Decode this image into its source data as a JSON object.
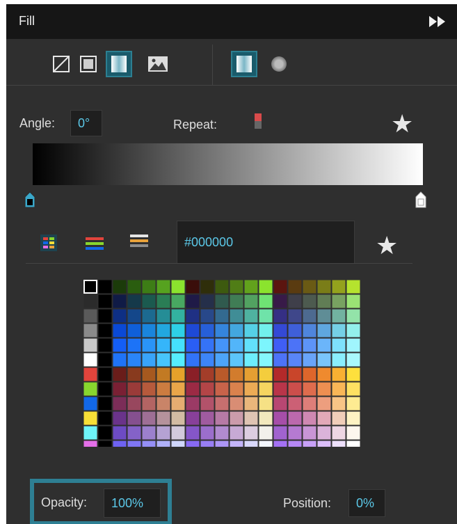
{
  "panel": {
    "title": "Fill"
  },
  "fill_type_tools": [
    {
      "name": "no-fill-icon",
      "selected": false
    },
    {
      "name": "solid-fill-icon",
      "selected": false
    },
    {
      "name": "linear-gradient-icon",
      "selected": true
    },
    {
      "name": "image-fill-icon",
      "selected": false
    }
  ],
  "gradient_type_tools": [
    {
      "name": "linear-gradient-icon",
      "selected": true
    },
    {
      "name": "radial-gradient-icon",
      "selected": false
    }
  ],
  "gradient": {
    "angle_label": "Angle:",
    "angle_value": "0°",
    "repeat_label": "Repeat:",
    "start_color": "#000000",
    "end_color": "#ffffff"
  },
  "color_input": {
    "value": "#000000"
  },
  "swatches": {
    "colors": [
      "#000000",
      "#000000",
      "#1b3b0a",
      "#2a5d0f",
      "#3d7d16",
      "#56a21f",
      "#8be32e",
      "#3a0e0a",
      "#2f2e0a",
      "#3d5a0f",
      "#507d16",
      "#62a21c",
      "#8be32e",
      "#5b150f",
      "#5a3b10",
      "#6a5a14",
      "#7a7d18",
      "#94a21d",
      "#b5e32e",
      "#2b2b2b",
      "#000000",
      "#101b46",
      "#15394a",
      "#1b5a4f",
      "#2a7d55",
      "#48a861",
      "#1f1a47",
      "#252f4a",
      "#305a4e",
      "#407d55",
      "#52a261",
      "#6fe374",
      "#381a48",
      "#3f3f4a",
      "#4d5a4f",
      "#617d55",
      "#78a261",
      "#9ae374",
      "#5a5a5a",
      "#000000",
      "#0e2f84",
      "#14478a",
      "#1c6a90",
      "#258d96",
      "#33b2a0",
      "#1f3084",
      "#28488a",
      "#336a90",
      "#408d96",
      "#4fb2a0",
      "#6fe3a9",
      "#352f84",
      "#3f478a",
      "#4d6a90",
      "#5f8d96",
      "#72b2a0",
      "#93e3a9",
      "#8a8a8a",
      "#000000",
      "#0a49d6",
      "#0f5fd9",
      "#1a85dc",
      "#22a7df",
      "#2ed0e6",
      "#1e49d6",
      "#275fd9",
      "#3585dc",
      "#43a7df",
      "#55d0e6",
      "#72f0ec",
      "#3449d6",
      "#3f5fd9",
      "#4f85dc",
      "#5fa7df",
      "#75d0e6",
      "#93f0ec",
      "#c8c8c8",
      "#000000",
      "#145ef5",
      "#1c73f7",
      "#2a94f8",
      "#35b5fa",
      "#45e1fc",
      "#2a5ef5",
      "#3573f7",
      "#4594f8",
      "#52b5fa",
      "#62e1fc",
      "#7cf5fd",
      "#405ef5",
      "#4c73f7",
      "#5d94f8",
      "#6bb5fa",
      "#7ee1fc",
      "#a0f5fd",
      "#ffffff",
      "#000000",
      "#1f73f7",
      "#2a85f8",
      "#39a4f9",
      "#47c5fb",
      "#56eefd",
      "#3273f7",
      "#3d85f8",
      "#4da4f9",
      "#5cc5fb",
      "#6deefd",
      "#85f8fd",
      "#4d73f7",
      "#5985f8",
      "#69a4f9",
      "#79c5fb",
      "#8aeefd",
      "#a9f8fd",
      "#e2443c",
      "#000000",
      "#6a1d1a",
      "#883a1e",
      "#a6591f",
      "#c27a23",
      "#e6a12a",
      "#8a1f27",
      "#a33d29",
      "#ba5a2a",
      "#d27c2d",
      "#e69f32",
      "#f4cd3d",
      "#b32a2a",
      "#c9452a",
      "#de662b",
      "#ef8a2e",
      "#f9b032",
      "#fee03d",
      "#88d62e",
      "#000000",
      "#7a2034",
      "#9a3b39",
      "#b65a3c",
      "#cc7c40",
      "#e9a649",
      "#9b2a44",
      "#b34547",
      "#c8634a",
      "#da824d",
      "#ecab55",
      "#f6d560",
      "#b93549",
      "#cc4e4b",
      "#df6c4d",
      "#ee8f51",
      "#f9b757",
      "#fee162",
      "#1268e8",
      "#000000",
      "#7b2d58",
      "#98475e",
      "#b36463",
      "#c98468",
      "#e6ad71",
      "#9b3a65",
      "#b2526a",
      "#c76f6f",
      "#d98d74",
      "#eab67b",
      "#f6e185",
      "#b84772",
      "#cc6075",
      "#de7e79",
      "#ed9e7e",
      "#f8c586",
      "#feeb92",
      "#f7df37",
      "#000000",
      "#6a338a",
      "#85508f",
      "#9e6f95",
      "#b5929b",
      "#d2bca3",
      "#88409a",
      "#a05b9f",
      "#b67aa5",
      "#cb9bab",
      "#dfc4b3",
      "#f2e9bd",
      "#a64ea8",
      "#bb69ad",
      "#cf88b2",
      "#e2a9b8",
      "#f1ceb9",
      "#fef2c3",
      "#6ef4f9",
      "#000000",
      "#6d4bc4",
      "#8462c8",
      "#9c80cd",
      "#b5a2d3",
      "#d2cadc",
      "#8556c8",
      "#9b6ecc",
      "#b18bd0",
      "#c7aad5",
      "#dccde0",
      "#f2f1eb",
      "#a163cf",
      "#b57ad2",
      "#c995d6",
      "#dbb3da",
      "#eed6e3",
      "#fdf6ee",
      "#e46fe8",
      "#000000",
      "#6e62f2",
      "#7f76f4",
      "#958ff6",
      "#afb0f8",
      "#cfd6fb",
      "#8769f3",
      "#987ef4",
      "#ad96f6",
      "#c3b4f8",
      "#d9d8fb",
      "#f3f6fd",
      "#a471f4",
      "#b688f5",
      "#c8a0f7",
      "#dbbef9",
      "#ede0fb",
      "#ffffff"
    ],
    "selected": "#000000"
  },
  "opacity": {
    "label": "Opacity:",
    "value": "100%"
  },
  "position": {
    "label": "Position:",
    "value": "0%"
  },
  "colors": {
    "accent": "#5bc8e8",
    "selection": "#2e7f93",
    "panel_bg": "#2f2f2f",
    "header_bg": "#161616"
  }
}
